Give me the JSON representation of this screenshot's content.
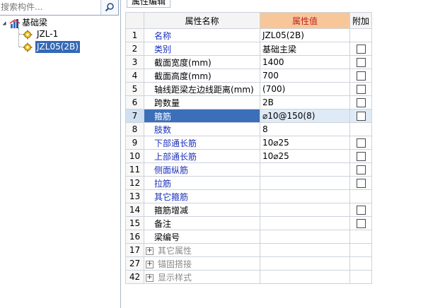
{
  "search": {
    "placeholder": "搜索构件..."
  },
  "tree": {
    "root": {
      "label": "基础梁"
    },
    "children": [
      {
        "label": "JZL-1",
        "selected": false
      },
      {
        "label": "JZL05(2B)",
        "selected": true
      }
    ]
  },
  "panel": {
    "tab_label": "属性编辑",
    "columns": {
      "name": "属性名称",
      "value": "属性值",
      "extra": "附加"
    },
    "rows": [
      {
        "num": "1",
        "name": "名称",
        "value": "JZL05(2B)",
        "color": "blue",
        "checkbox": false
      },
      {
        "num": "2",
        "name": "类别",
        "value": "基础主梁",
        "color": "blue",
        "checkbox": true
      },
      {
        "num": "3",
        "name": "截面宽度(mm)",
        "value": "1400",
        "color": "black",
        "checkbox": true
      },
      {
        "num": "4",
        "name": "截面高度(mm)",
        "value": "700",
        "color": "black",
        "checkbox": true
      },
      {
        "num": "5",
        "name": "轴线距梁左边线距离(mm)",
        "value": "(700)",
        "color": "black",
        "checkbox": true
      },
      {
        "num": "6",
        "name": "跨数量",
        "value": "2B",
        "color": "black",
        "checkbox": true
      },
      {
        "num": "7",
        "name": "箍筋",
        "value": "⌀10@150(8)",
        "color": "blue",
        "checkbox": true,
        "selected": true
      },
      {
        "num": "8",
        "name": "肢数",
        "value": "8",
        "color": "blue",
        "checkbox": false
      },
      {
        "num": "9",
        "name": "下部通长筋",
        "value": "10⌀25",
        "color": "blue",
        "checkbox": true
      },
      {
        "num": "10",
        "name": "上部通长筋",
        "value": "10⌀25",
        "color": "blue",
        "checkbox": true
      },
      {
        "num": "11",
        "name": "侧面纵筋",
        "value": "",
        "color": "blue",
        "checkbox": true
      },
      {
        "num": "12",
        "name": "拉筋",
        "value": "",
        "color": "blue",
        "checkbox": true
      },
      {
        "num": "13",
        "name": "其它箍筋",
        "value": "",
        "color": "blue",
        "checkbox": false
      },
      {
        "num": "14",
        "name": "箍筋增减",
        "value": "",
        "color": "black",
        "checkbox": true
      },
      {
        "num": "15",
        "name": "备注",
        "value": "",
        "color": "black",
        "checkbox": true
      },
      {
        "num": "16",
        "name": "梁编号",
        "value": "",
        "color": "black",
        "checkbox": false
      },
      {
        "num": "17",
        "name": "其它属性",
        "value": "",
        "color": "gray",
        "checkbox": false,
        "expandable": true
      },
      {
        "num": "27",
        "name": "锚固搭接",
        "value": "",
        "color": "gray",
        "checkbox": false,
        "expandable": true
      },
      {
        "num": "42",
        "name": "显示样式",
        "value": "",
        "color": "gray",
        "checkbox": false,
        "expandable": true
      }
    ]
  },
  "icons": {
    "search": "search-icon",
    "tree_root": "beam-group-icon",
    "tree_item": "gear-icon",
    "expand": "plus-expand-icon"
  }
}
